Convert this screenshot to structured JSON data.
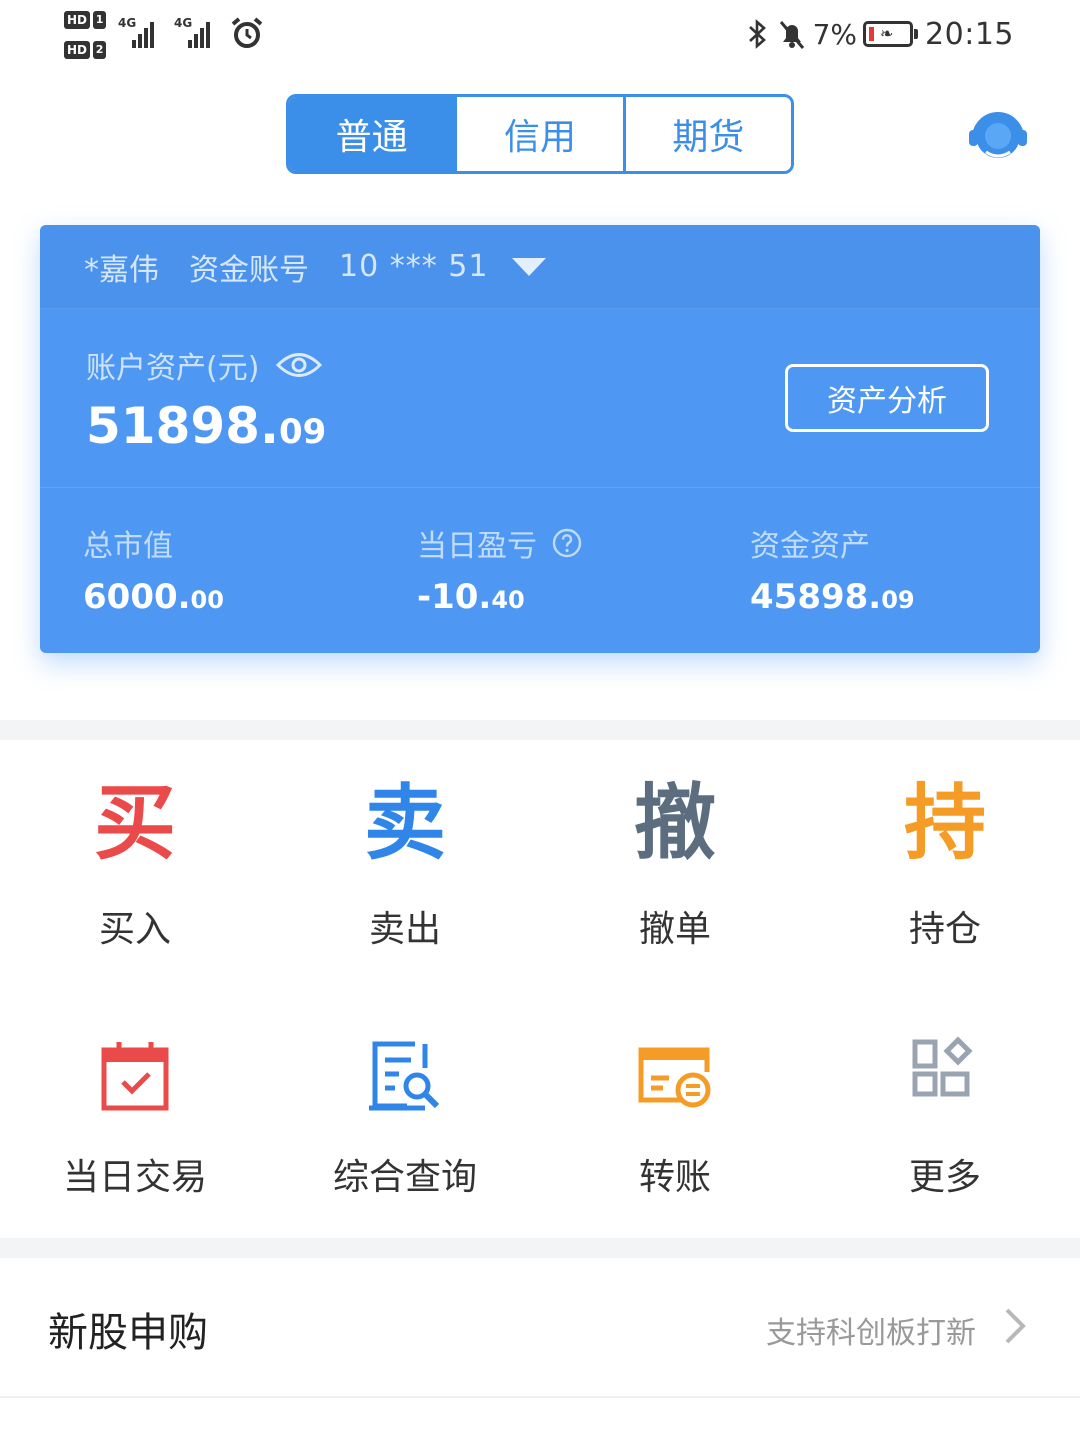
{
  "status_bar": {
    "sim1_hd": "HD",
    "sim1_num": "1",
    "sim2_hd": "HD",
    "sim2_num": "2",
    "network1": "4G",
    "network2": "4G",
    "battery_percent": "7%",
    "time": "20:15"
  },
  "tabs": [
    {
      "label": "普通",
      "active": true
    },
    {
      "label": "信用",
      "active": false
    },
    {
      "label": "期货",
      "active": false
    }
  ],
  "account": {
    "name": "*嘉伟",
    "account_label": "资金账号",
    "account_number": "10 *** 51",
    "asset_label": "账户资产(元)",
    "asset_int": "51898.",
    "asset_dec": "09",
    "analysis_button": "资产分析",
    "stats": [
      {
        "label": "总市值",
        "int": "6000.",
        "dec": "00"
      },
      {
        "label": "当日盈亏",
        "int": "-10.",
        "dec": "40"
      },
      {
        "label": "资金资产",
        "int": "45898.",
        "dec": "09"
      }
    ]
  },
  "functions": [
    {
      "icon_char": "买",
      "icon_color": "#ea4a4a",
      "label": "买入"
    },
    {
      "icon_char": "卖",
      "icon_color": "#2f86e8",
      "label": "卖出"
    },
    {
      "icon_char": "撤",
      "icon_color": "#5c6d80",
      "label": "撤单"
    },
    {
      "icon_char": "持",
      "icon_color": "#f59c26",
      "label": "持仓"
    },
    {
      "icon": "calendar-check-icon",
      "icon_color": "#ea4a4a",
      "label": "当日交易"
    },
    {
      "icon": "document-search-icon",
      "icon_color": "#2f86e8",
      "label": "综合查询"
    },
    {
      "icon": "card-transfer-icon",
      "icon_color": "#f59c26",
      "label": "转账"
    },
    {
      "icon": "grid-more-icon",
      "icon_color": "#9aa3b2",
      "label": "更多"
    }
  ],
  "ipo": {
    "title": "新股申购",
    "hint": "支持科创板打新"
  },
  "colors": {
    "accent": "#3b8fe8",
    "card": "#4e98f3",
    "buy": "#ea4a4a",
    "sell": "#2f86e8",
    "cancel": "#5c6d80",
    "hold": "#f59c26"
  }
}
